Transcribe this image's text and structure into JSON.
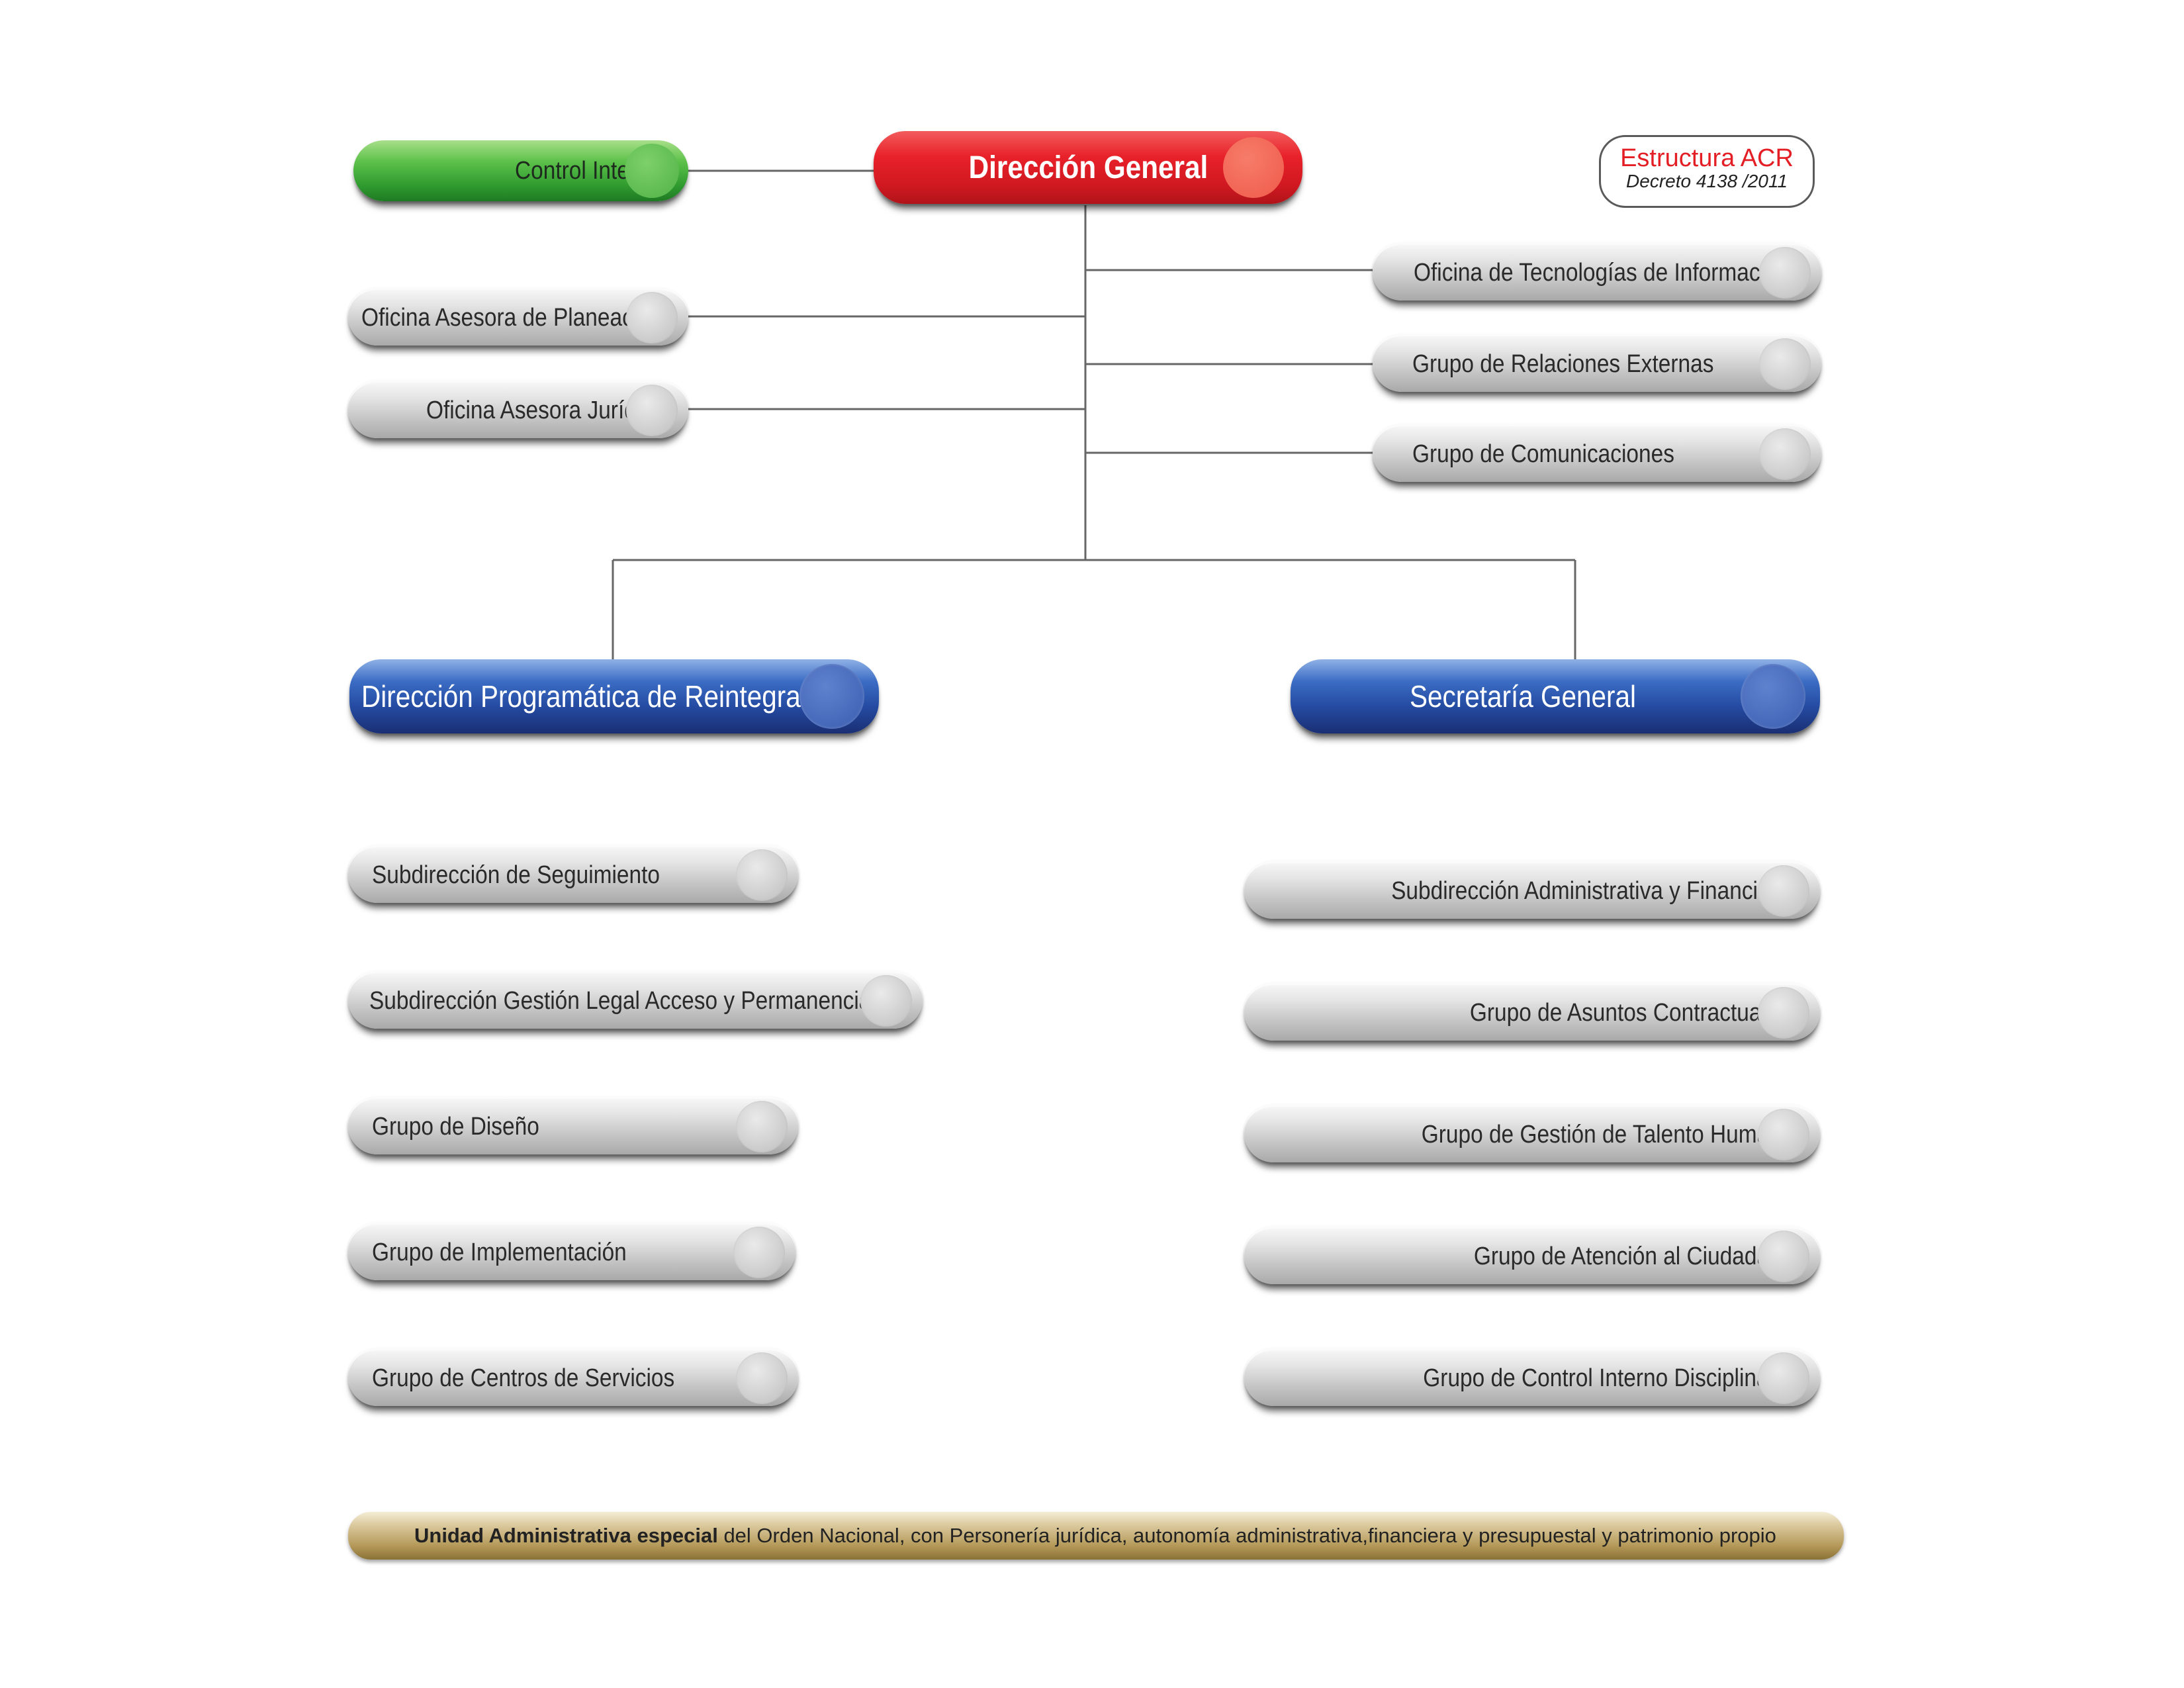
{
  "badge": {
    "title": "Estructura ACR",
    "subtitle": "Decreto 4138 /2011"
  },
  "top": {
    "direccion_general": "Dirección General",
    "control_interno": "Control Interno"
  },
  "left_offices": [
    "Oficina Asesora de Planeación",
    "Oficina Asesora Jurídica"
  ],
  "right_groups": [
    "Oficina de Tecnologías de Información",
    "Grupo de Relaciones Externas",
    "Grupo de Comunicaciones"
  ],
  "branches": {
    "left": "Dirección Programática de Reintegración",
    "right": "Secretaría General"
  },
  "left_units": [
    "Subdirección de Seguimiento",
    "Subdirección Gestión Legal Acceso y Permanencia",
    "Grupo de Diseño",
    "Grupo de Implementación",
    "Grupo de Centros de Servicios"
  ],
  "right_units": [
    "Subdirección Administrativa y Financiera",
    "Grupo de Asuntos Contractuales",
    "Grupo de Gestión de Talento Humano",
    "Grupo de Atención al Ciudadano",
    "Grupo de Control Interno Disciplinario"
  ],
  "footer": {
    "bold": "Unidad Administrativa especial",
    "rest": " del Orden Nacional, con Personería jurídica, autonomía administrativa,financiera y presupuestal y patrimonio propio"
  }
}
